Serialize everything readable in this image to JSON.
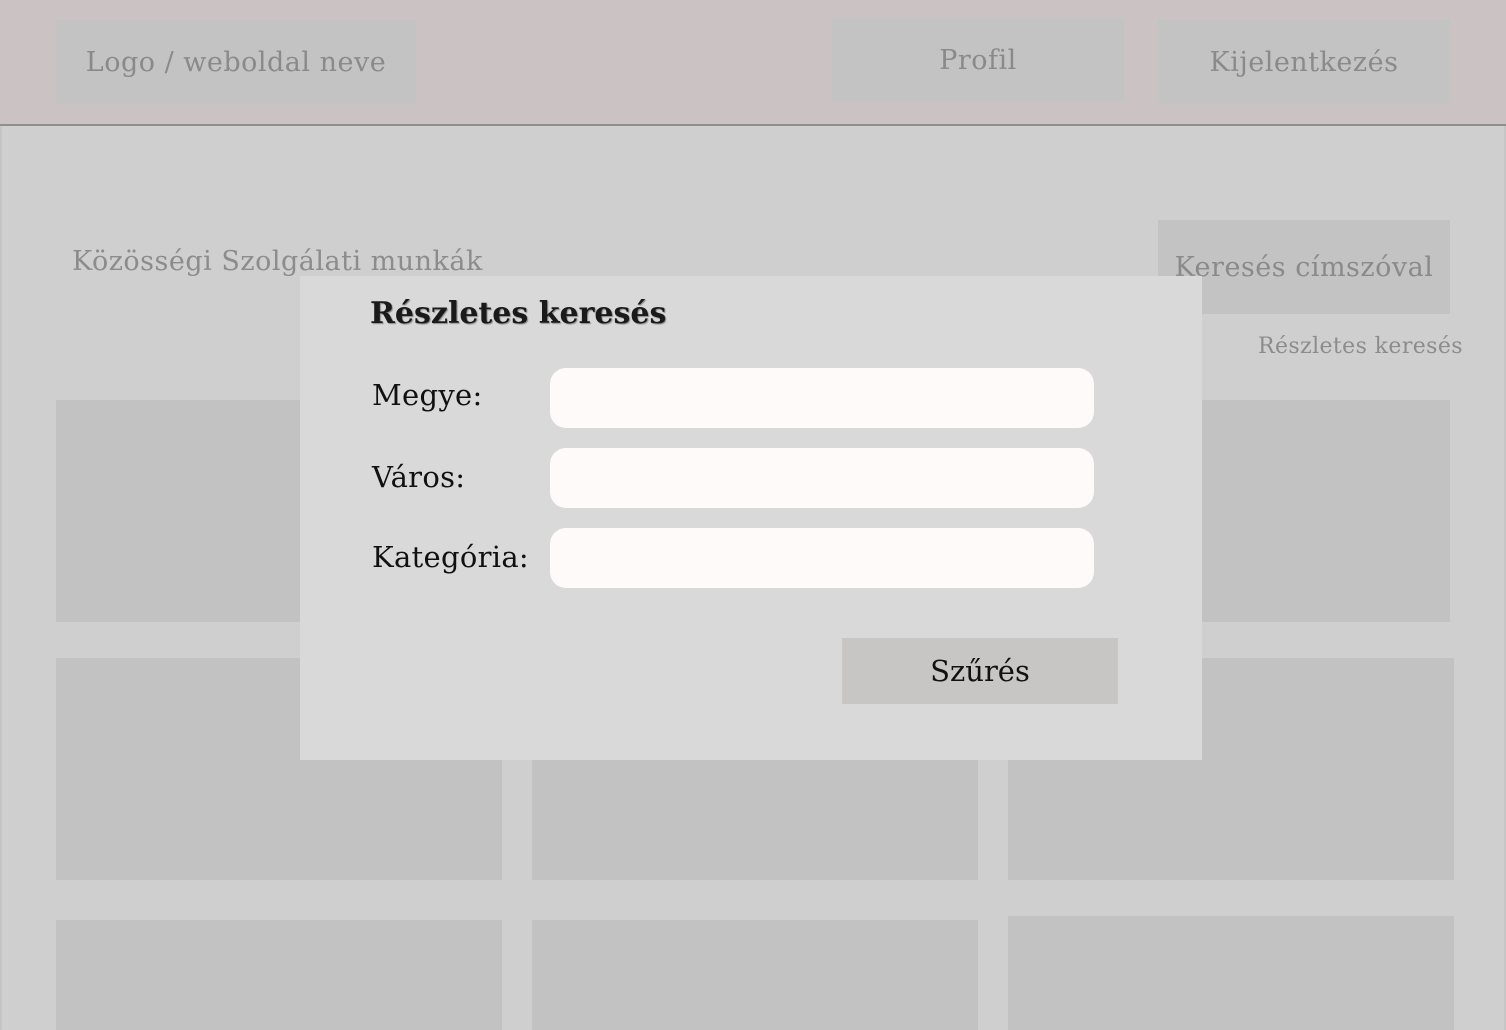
{
  "header": {
    "logo_text": "Logo / weboldal neve",
    "profile_label": "Profil",
    "logout_label": "Kijelentkezés"
  },
  "main": {
    "heading": "Közösségi Szolgálati munkák",
    "search_label": "Keresés címszóval",
    "advanced_search_link": "Részletes keresés"
  },
  "modal": {
    "title": "Részletes keresés",
    "fields": [
      {
        "label": "Megye:",
        "value": ""
      },
      {
        "label": "Város:",
        "value": ""
      },
      {
        "label": "Kategória:",
        "value": ""
      }
    ],
    "submit_label": "Szűrés"
  },
  "colors": {
    "header_bg": "#cbc2c3",
    "page_bg": "#cfcfcf",
    "card_bg": "#c2c2c2",
    "modal_bg": "#d9d9d9",
    "input_bg": "#fdfaf9",
    "button_bg": "#c8c5c5"
  }
}
